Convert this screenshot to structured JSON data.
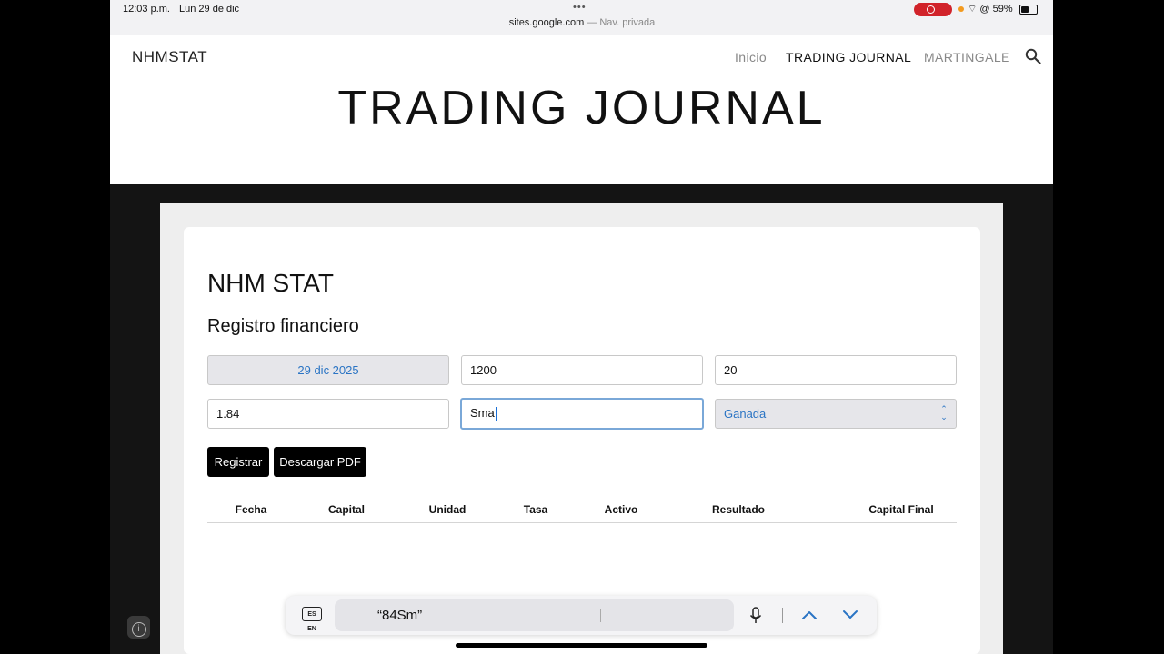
{
  "status_bar": {
    "time": "12:03 p.m.",
    "date": "Lun 29 de dic",
    "url": "sites.google.com",
    "url_suffix": "— Nav. privada",
    "battery": "59%",
    "battery_level": 0.59
  },
  "site": {
    "brand": "NHMSTAT",
    "nav": [
      "Inicio",
      "TRADING JOURNAL",
      "MARTINGALE"
    ],
    "active_nav": "TRADING JOURNAL",
    "page_title": "TRADING JOURNAL"
  },
  "app": {
    "title": "NHM STAT",
    "subtitle": "Registro financiero",
    "fields": {
      "date": "29 dic 2025",
      "capital": "1200",
      "unit": "20",
      "rate": "1.84",
      "asset": "Sma",
      "result": "Ganada"
    },
    "buttons": {
      "register": "Registrar",
      "download": "Descargar PDF"
    },
    "table_headers": [
      "Fecha",
      "Capital",
      "Unidad",
      "Tasa",
      "Activo",
      "Resultado",
      "Capital Final"
    ]
  },
  "keyboard": {
    "language": "ES EN",
    "suggestion": "“84Sm”"
  },
  "colors": {
    "accent_blue": "#2a74c4",
    "record_red": "#d1232a",
    "button_black": "#000000"
  }
}
